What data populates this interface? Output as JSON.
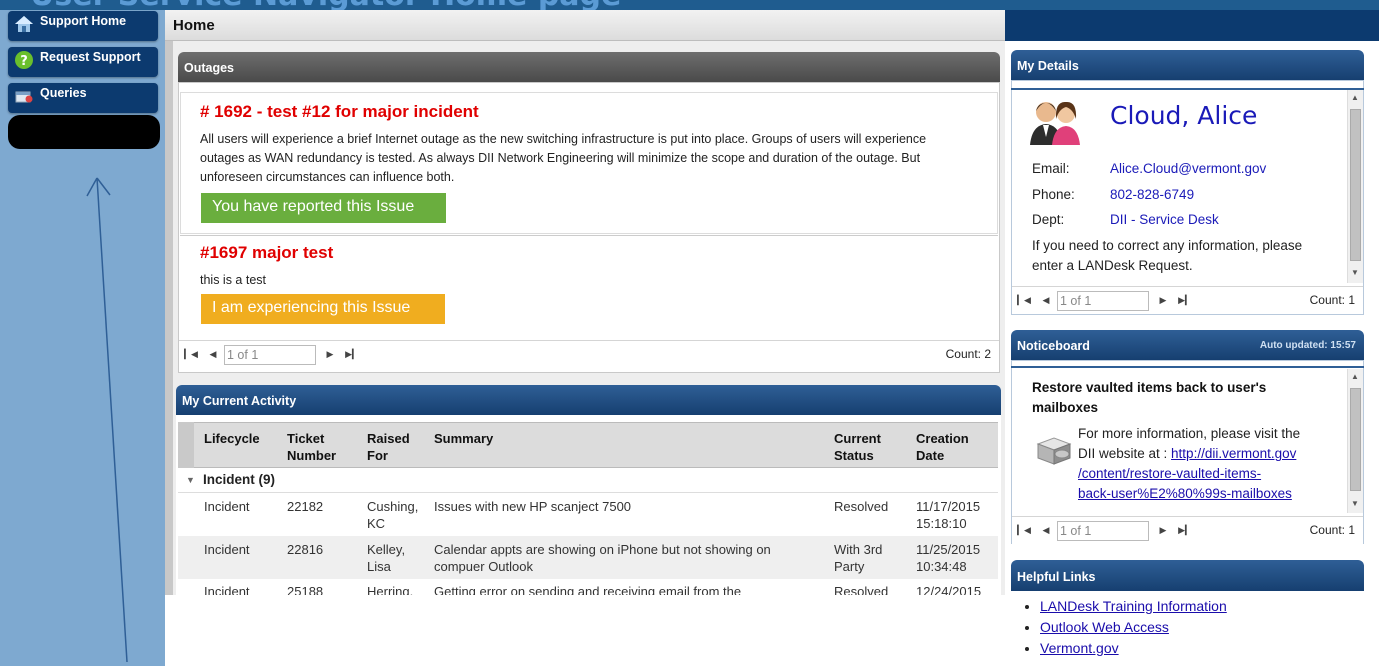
{
  "banner": {
    "title": "User Service Navigator Home page"
  },
  "nav": {
    "items": [
      {
        "label": "Support Home"
      },
      {
        "label": "Request Support"
      },
      {
        "label": "Queries"
      }
    ]
  },
  "home": {
    "title": "Home"
  },
  "outages": {
    "header": "Outages",
    "items": [
      {
        "title": "# 1692 - test #12 for major incident",
        "desc_lines": [
          "All users will experience a brief Internet outage as the new switching infrastructure is put into place. Groups of users will experience",
          "outages as WAN redundancy is tested. As always DII Network Engineering will minimize the scope and duration of the outage. But",
          "unforeseen circumstances can influence both."
        ],
        "button": "You have reported this Issue"
      },
      {
        "title": "#1697 major test",
        "desc_lines": [
          "this is a test"
        ],
        "button": "I am experiencing this Issue"
      }
    ],
    "pager": {
      "page": "1 of 1",
      "count": "Count: 2"
    }
  },
  "activity": {
    "header": "My Current Activity",
    "columns": [
      [
        "Lifecycle"
      ],
      [
        "Ticket",
        "Number"
      ],
      [
        "Raised",
        "For"
      ],
      [
        "Summary"
      ],
      [
        "Current",
        "Status"
      ],
      [
        "Creation",
        "Date"
      ]
    ],
    "group": "Incident (9)",
    "rows": [
      {
        "lifecycle": "Incident",
        "ticket": "22182",
        "raised": [
          "Cushing,",
          "KC"
        ],
        "summary": [
          "Issues with new HP scanject 7500"
        ],
        "status": [
          "Resolved"
        ],
        "date": [
          "11/17/2015",
          "15:18:10"
        ]
      },
      {
        "lifecycle": "Incident",
        "ticket": "22816",
        "raised": [
          "Kelley,",
          "Lisa"
        ],
        "summary": [
          "Calendar appts are showing on iPhone but not showing on",
          "compuer Outlook"
        ],
        "status": [
          "With 3rd",
          "Party"
        ],
        "date": [
          "11/25/2015",
          "10:34:48"
        ]
      },
      {
        "lifecycle": "Incident",
        "ticket": "25188",
        "raised": [
          "Herring,",
          ""
        ],
        "summary": [
          "Getting error on sending and receiving email from the",
          ""
        ],
        "status": [
          "Resolved"
        ],
        "date": [
          "12/24/2015",
          ""
        ]
      }
    ]
  },
  "details": {
    "header": "My Details",
    "name": "Cloud, Alice",
    "email_label": "Email:",
    "email": "Alice.Cloud@vermont.gov",
    "phone_label": "Phone:",
    "phone": "802-828-6749",
    "dept_label": "Dept:",
    "dept": "DII - Service Desk",
    "note_lines": [
      "If you need to correct any information, please",
      "enter a LANDesk Request."
    ],
    "pager": {
      "page": "1 of 1",
      "count": "Count: 1"
    }
  },
  "noticeboard": {
    "header": "Noticeboard",
    "updated": "Auto updated: 15:57",
    "title_lines": [
      "Restore vaulted items back to user's",
      "mailboxes"
    ],
    "text_lines": [
      "For more information, please visit the",
      "DII website at : "
    ],
    "link_lines": [
      "http://dii.vermont.gov",
      "/content/restore-vaulted-items-",
      "back-user%E2%80%99s-mailboxes"
    ],
    "pager": {
      "page": "1 of 1",
      "count": "Count: 1"
    }
  },
  "helpful_links": {
    "header": "Helpful Links",
    "links": [
      "LANDesk Training Information",
      "Outlook Web Access",
      "Vermont.gov"
    ]
  },
  "colors": {
    "nav_bg": "#7ea9d0",
    "nav_button": "#0c3a6f",
    "reported_button": "#6aae3e",
    "experiencing_button": "#f0ad1f",
    "outage_title": "#e00000"
  }
}
